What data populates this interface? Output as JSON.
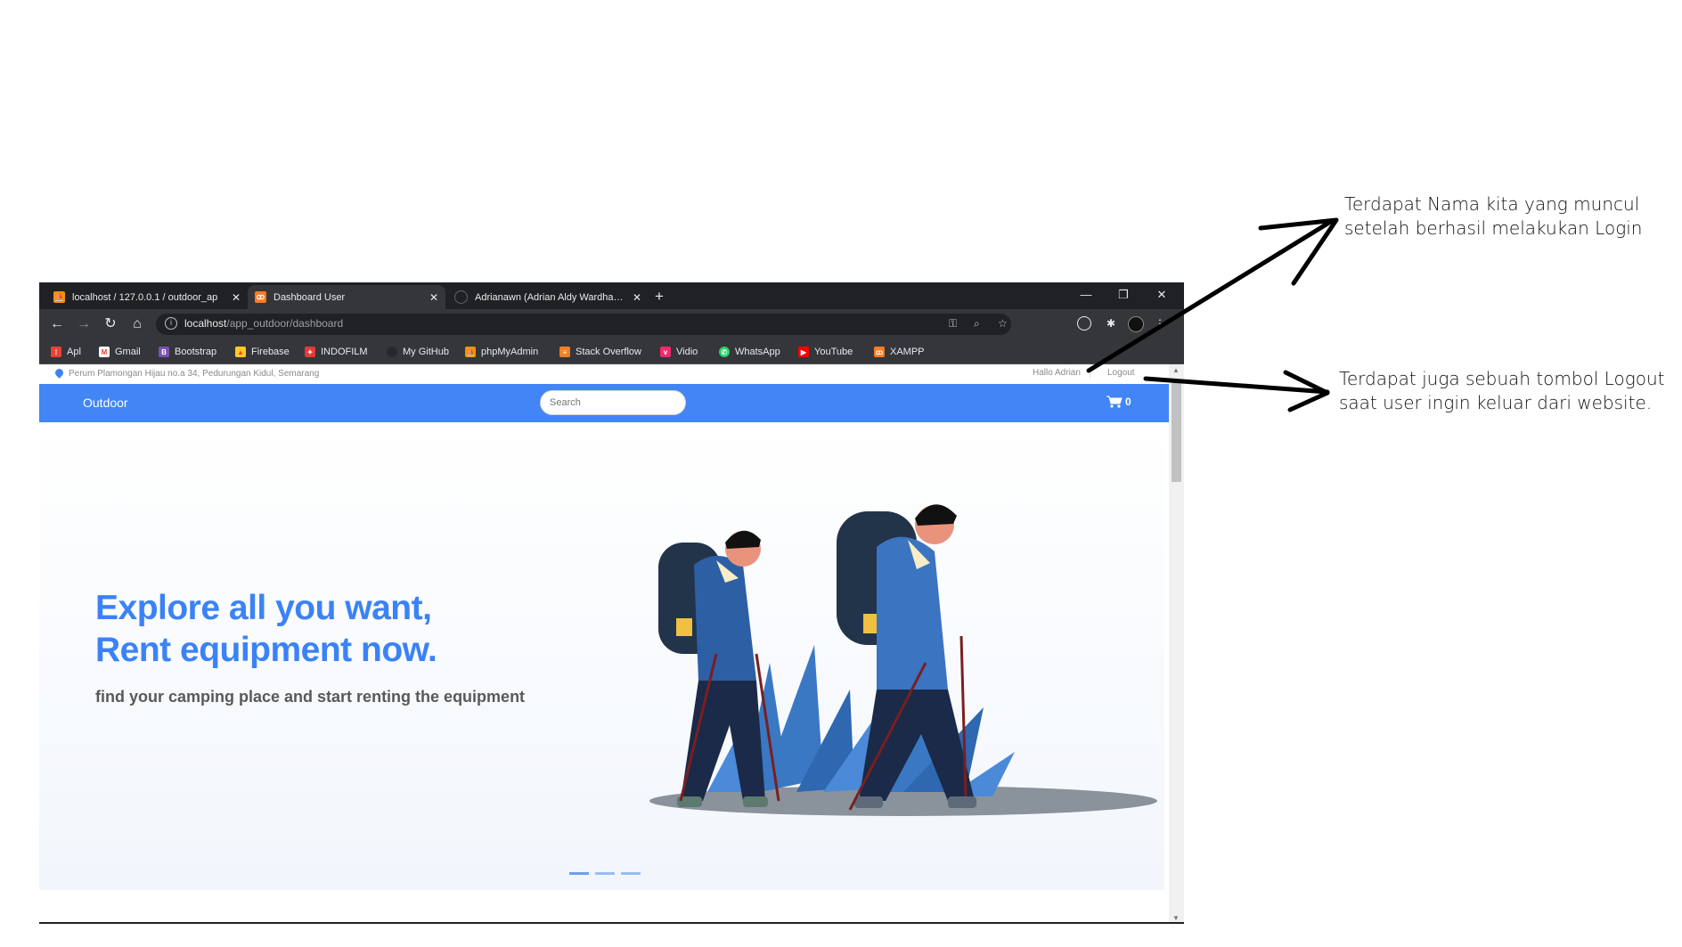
{
  "browser": {
    "tabs": [
      {
        "title": "localhost / 127.0.0.1 / outdoor_ap",
        "icon": "phpmyadmin-icon",
        "active": false
      },
      {
        "title": "Dashboard User",
        "icon": "xampp-icon",
        "active": true
      },
      {
        "title": "Adrianawn (Adrian Aldy Wardhana)",
        "icon": "github-icon",
        "active": false
      }
    ],
    "url_host": "localhost",
    "url_path": "/app_outdoor/dashboard",
    "bookmarks": [
      {
        "label": "Apl",
        "icon": "apps-grid-icon",
        "color": "#ea4335"
      },
      {
        "label": "Gmail",
        "icon": "gmail-icon",
        "color": "#ea4335"
      },
      {
        "label": "Bootstrap",
        "icon": "bootstrap-icon",
        "color": "#7952b3"
      },
      {
        "label": "Firebase",
        "icon": "firebase-icon",
        "color": "#ffca28"
      },
      {
        "label": "INDOFILM",
        "icon": "indofilm-icon",
        "color": "#e53935"
      },
      {
        "label": "My GitHub",
        "icon": "github-icon",
        "color": "#24292e"
      },
      {
        "label": "phpMyAdmin",
        "icon": "phpmyadmin-icon",
        "color": "#f29111"
      },
      {
        "label": "Stack Overflow",
        "icon": "stackoverflow-icon",
        "color": "#f48024"
      },
      {
        "label": "Vidio",
        "icon": "vidio-icon",
        "color": "#ee2b6c"
      },
      {
        "label": "WhatsApp",
        "icon": "whatsapp-icon",
        "color": "#25d366"
      },
      {
        "label": "YouTube",
        "icon": "youtube-icon",
        "color": "#ff0000"
      },
      {
        "label": "XAMPP",
        "icon": "xampp-icon",
        "color": "#fb7a24"
      }
    ]
  },
  "page": {
    "address": "Perum Plamongan Hijau no.a 34, Pedurungan Kidul, Semarang",
    "greeting": "Hallo Adrian",
    "logout_label": "Logout",
    "brand": "Outdoor",
    "search_placeholder": "Search",
    "cart_count": "0",
    "hero_line1": "Explore all you want,",
    "hero_line2": "Rent equipment now.",
    "hero_sub": "find your camping place and start renting the equipment",
    "accent_color": "#4285f4"
  },
  "annotations": {
    "note1_line1": "Terdapat Nama kita yang muncul",
    "note1_line2": "setelah berhasil melakukan Login",
    "note2_line1": "Terdapat juga sebuah tombol Logout",
    "note2_line2": "saat user ingin keluar dari website."
  }
}
